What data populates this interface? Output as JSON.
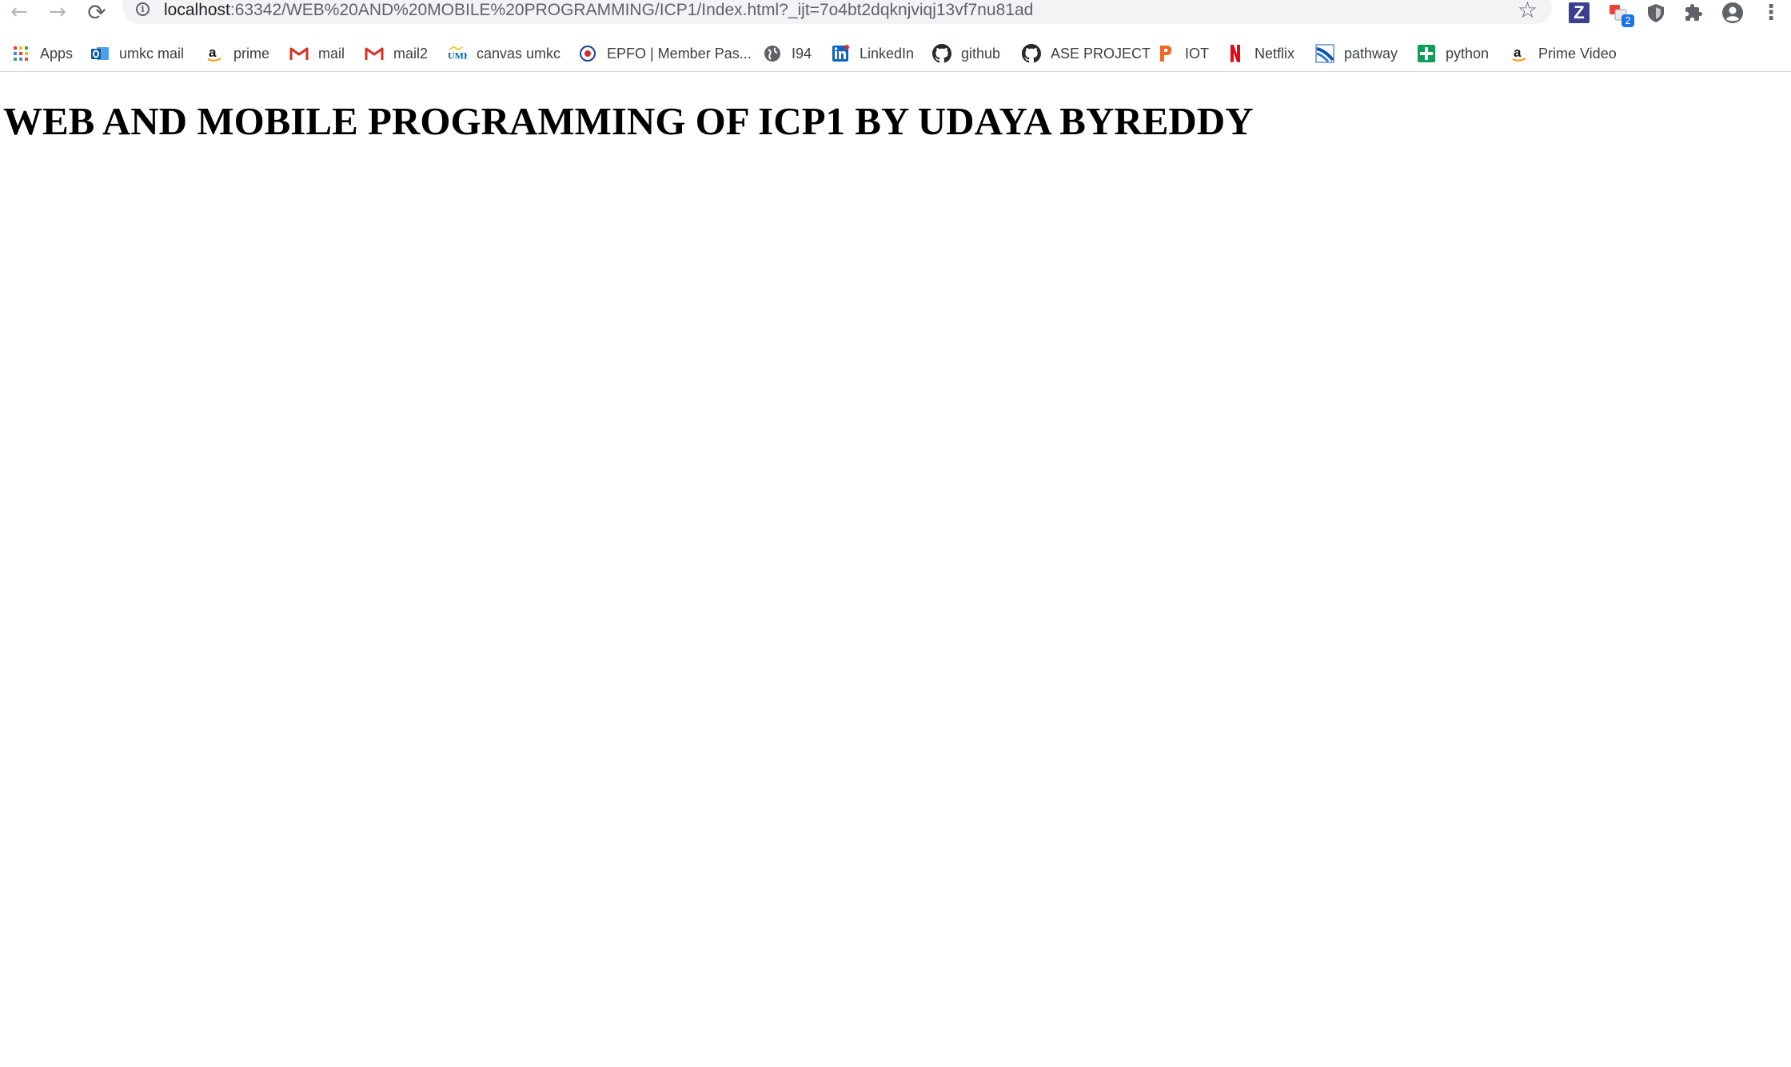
{
  "browser": {
    "address_bar": {
      "url_host": "localhost",
      "url_rest": ":63342/WEB%20AND%20MOBILE%20PROGRAMMING/ICP1/Index.html?_ijt=7o4bt2dqknjviqj13vf7nu81ad"
    },
    "nav": {
      "back_icon": "arrow-left",
      "forward_icon": "arrow-right",
      "reload_icon": "reload"
    },
    "extensions": {
      "z_label": "Z",
      "translate_badge": "2"
    },
    "bookmarks": [
      {
        "label": "Apps",
        "icon": "apps-grid"
      },
      {
        "label": "umkc mail",
        "icon": "outlook"
      },
      {
        "label": "prime",
        "icon": "amazon"
      },
      {
        "label": "mail",
        "icon": "gmail"
      },
      {
        "label": "mail2",
        "icon": "gmail"
      },
      {
        "label": "canvas umkc",
        "icon": "umkc"
      },
      {
        "label": "EPFO | Member Pas...",
        "icon": "epfo"
      },
      {
        "label": "I94",
        "icon": "globe"
      },
      {
        "label": "LinkedIn",
        "icon": "linkedin"
      },
      {
        "label": "github",
        "icon": "github"
      },
      {
        "label": "ASE PROJECT",
        "icon": "github"
      },
      {
        "label": "IOT",
        "icon": "p-logo"
      },
      {
        "label": "Netflix",
        "icon": "netflix"
      },
      {
        "label": "pathway",
        "icon": "pathway"
      },
      {
        "label": "python",
        "icon": "plus-square"
      },
      {
        "label": "Prime Video",
        "icon": "amazon"
      }
    ],
    "colors": {
      "linkedin": "#0a66c2",
      "gmail": "#d93025",
      "netflix": "#e50914",
      "python_green": "#0f9d58",
      "iot_orange": "#f26522",
      "translate_badge": "#1a73e8"
    }
  },
  "page": {
    "heading": "WEB AND MOBILE PROGRAMMING OF ICP1 BY UDAYA BYREDDY"
  }
}
